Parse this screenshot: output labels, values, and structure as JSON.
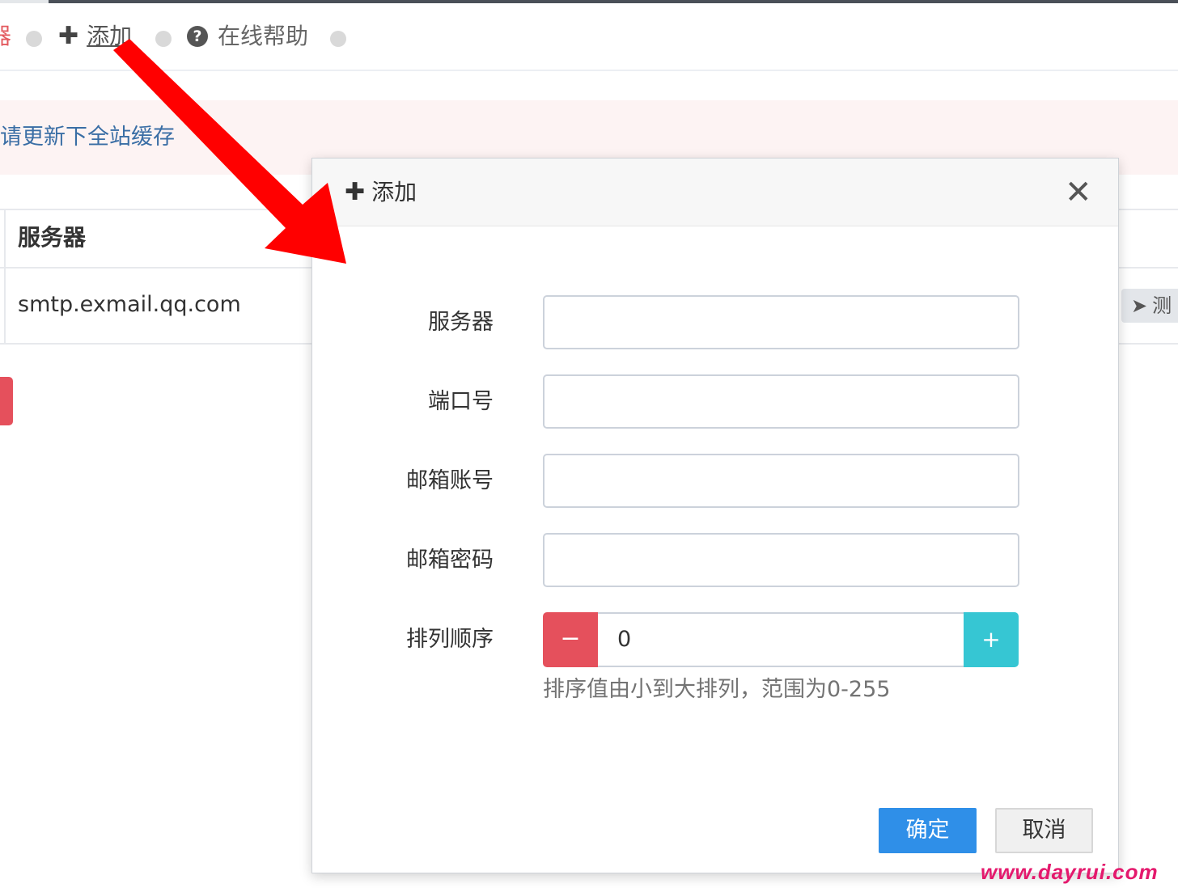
{
  "toolbar": {
    "clipped_label": "器",
    "add_label": "添加",
    "help_label": "在线帮助"
  },
  "alert": {
    "message": "请更新下全站缓存"
  },
  "table": {
    "column_server": "服务器",
    "rows": [
      {
        "server": "smtp.exmail.qq.com",
        "action_label": "测"
      }
    ]
  },
  "modal": {
    "title": "添加",
    "fields": {
      "server": {
        "label": "服务器",
        "value": ""
      },
      "port": {
        "label": "端口号",
        "value": ""
      },
      "account": {
        "label": "邮箱账号",
        "value": ""
      },
      "password": {
        "label": "邮箱密码",
        "value": ""
      },
      "order": {
        "label": "排列顺序",
        "value": "0",
        "minus": "−",
        "plus": "+"
      }
    },
    "help_text": "排序值由小到大排列，范围为0-255",
    "confirm_label": "确定",
    "cancel_label": "取消"
  },
  "watermark": "www.dayrui.com",
  "colors": {
    "primary": "#2f8fe8",
    "danger": "#e5505c",
    "info": "#36c6d3",
    "link": "#3a6ea5",
    "annotation_arrow": "#ff0000"
  }
}
